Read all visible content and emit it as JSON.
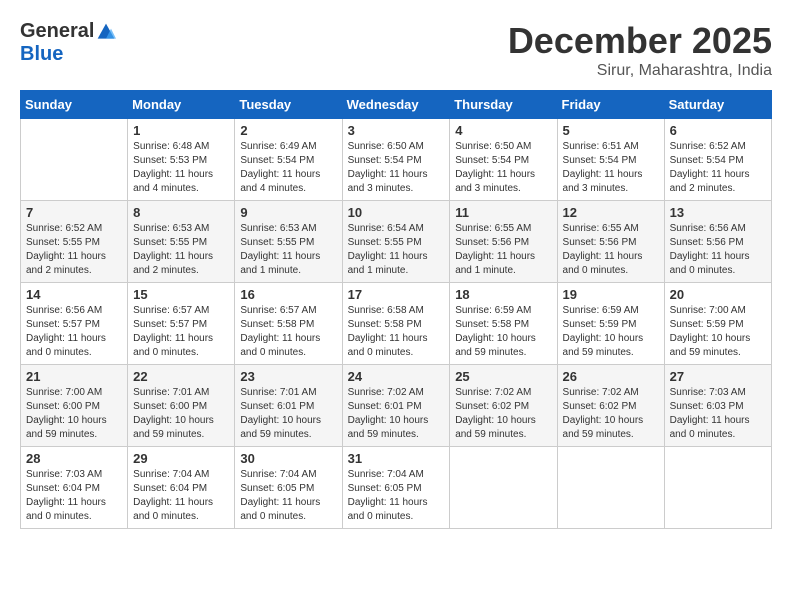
{
  "logo": {
    "general": "General",
    "blue": "Blue"
  },
  "title": {
    "month_year": "December 2025",
    "location": "Sirur, Maharashtra, India"
  },
  "days_of_week": [
    "Sunday",
    "Monday",
    "Tuesday",
    "Wednesday",
    "Thursday",
    "Friday",
    "Saturday"
  ],
  "weeks": [
    [
      {
        "day": "",
        "sunrise": "",
        "sunset": "",
        "daylight": ""
      },
      {
        "day": "1",
        "sunrise": "Sunrise: 6:48 AM",
        "sunset": "Sunset: 5:53 PM",
        "daylight": "Daylight: 11 hours and 4 minutes."
      },
      {
        "day": "2",
        "sunrise": "Sunrise: 6:49 AM",
        "sunset": "Sunset: 5:54 PM",
        "daylight": "Daylight: 11 hours and 4 minutes."
      },
      {
        "day": "3",
        "sunrise": "Sunrise: 6:50 AM",
        "sunset": "Sunset: 5:54 PM",
        "daylight": "Daylight: 11 hours and 3 minutes."
      },
      {
        "day": "4",
        "sunrise": "Sunrise: 6:50 AM",
        "sunset": "Sunset: 5:54 PM",
        "daylight": "Daylight: 11 hours and 3 minutes."
      },
      {
        "day": "5",
        "sunrise": "Sunrise: 6:51 AM",
        "sunset": "Sunset: 5:54 PM",
        "daylight": "Daylight: 11 hours and 3 minutes."
      },
      {
        "day": "6",
        "sunrise": "Sunrise: 6:52 AM",
        "sunset": "Sunset: 5:54 PM",
        "daylight": "Daylight: 11 hours and 2 minutes."
      }
    ],
    [
      {
        "day": "7",
        "sunrise": "Sunrise: 6:52 AM",
        "sunset": "Sunset: 5:55 PM",
        "daylight": "Daylight: 11 hours and 2 minutes."
      },
      {
        "day": "8",
        "sunrise": "Sunrise: 6:53 AM",
        "sunset": "Sunset: 5:55 PM",
        "daylight": "Daylight: 11 hours and 2 minutes."
      },
      {
        "day": "9",
        "sunrise": "Sunrise: 6:53 AM",
        "sunset": "Sunset: 5:55 PM",
        "daylight": "Daylight: 11 hours and 1 minute."
      },
      {
        "day": "10",
        "sunrise": "Sunrise: 6:54 AM",
        "sunset": "Sunset: 5:55 PM",
        "daylight": "Daylight: 11 hours and 1 minute."
      },
      {
        "day": "11",
        "sunrise": "Sunrise: 6:55 AM",
        "sunset": "Sunset: 5:56 PM",
        "daylight": "Daylight: 11 hours and 1 minute."
      },
      {
        "day": "12",
        "sunrise": "Sunrise: 6:55 AM",
        "sunset": "Sunset: 5:56 PM",
        "daylight": "Daylight: 11 hours and 0 minutes."
      },
      {
        "day": "13",
        "sunrise": "Sunrise: 6:56 AM",
        "sunset": "Sunset: 5:56 PM",
        "daylight": "Daylight: 11 hours and 0 minutes."
      }
    ],
    [
      {
        "day": "14",
        "sunrise": "Sunrise: 6:56 AM",
        "sunset": "Sunset: 5:57 PM",
        "daylight": "Daylight: 11 hours and 0 minutes."
      },
      {
        "day": "15",
        "sunrise": "Sunrise: 6:57 AM",
        "sunset": "Sunset: 5:57 PM",
        "daylight": "Daylight: 11 hours and 0 minutes."
      },
      {
        "day": "16",
        "sunrise": "Sunrise: 6:57 AM",
        "sunset": "Sunset: 5:58 PM",
        "daylight": "Daylight: 11 hours and 0 minutes."
      },
      {
        "day": "17",
        "sunrise": "Sunrise: 6:58 AM",
        "sunset": "Sunset: 5:58 PM",
        "daylight": "Daylight: 11 hours and 0 minutes."
      },
      {
        "day": "18",
        "sunrise": "Sunrise: 6:59 AM",
        "sunset": "Sunset: 5:58 PM",
        "daylight": "Daylight: 10 hours and 59 minutes."
      },
      {
        "day": "19",
        "sunrise": "Sunrise: 6:59 AM",
        "sunset": "Sunset: 5:59 PM",
        "daylight": "Daylight: 10 hours and 59 minutes."
      },
      {
        "day": "20",
        "sunrise": "Sunrise: 7:00 AM",
        "sunset": "Sunset: 5:59 PM",
        "daylight": "Daylight: 10 hours and 59 minutes."
      }
    ],
    [
      {
        "day": "21",
        "sunrise": "Sunrise: 7:00 AM",
        "sunset": "Sunset: 6:00 PM",
        "daylight": "Daylight: 10 hours and 59 minutes."
      },
      {
        "day": "22",
        "sunrise": "Sunrise: 7:01 AM",
        "sunset": "Sunset: 6:00 PM",
        "daylight": "Daylight: 10 hours and 59 minutes."
      },
      {
        "day": "23",
        "sunrise": "Sunrise: 7:01 AM",
        "sunset": "Sunset: 6:01 PM",
        "daylight": "Daylight: 10 hours and 59 minutes."
      },
      {
        "day": "24",
        "sunrise": "Sunrise: 7:02 AM",
        "sunset": "Sunset: 6:01 PM",
        "daylight": "Daylight: 10 hours and 59 minutes."
      },
      {
        "day": "25",
        "sunrise": "Sunrise: 7:02 AM",
        "sunset": "Sunset: 6:02 PM",
        "daylight": "Daylight: 10 hours and 59 minutes."
      },
      {
        "day": "26",
        "sunrise": "Sunrise: 7:02 AM",
        "sunset": "Sunset: 6:02 PM",
        "daylight": "Daylight: 10 hours and 59 minutes."
      },
      {
        "day": "27",
        "sunrise": "Sunrise: 7:03 AM",
        "sunset": "Sunset: 6:03 PM",
        "daylight": "Daylight: 11 hours and 0 minutes."
      }
    ],
    [
      {
        "day": "28",
        "sunrise": "Sunrise: 7:03 AM",
        "sunset": "Sunset: 6:04 PM",
        "daylight": "Daylight: 11 hours and 0 minutes."
      },
      {
        "day": "29",
        "sunrise": "Sunrise: 7:04 AM",
        "sunset": "Sunset: 6:04 PM",
        "daylight": "Daylight: 11 hours and 0 minutes."
      },
      {
        "day": "30",
        "sunrise": "Sunrise: 7:04 AM",
        "sunset": "Sunset: 6:05 PM",
        "daylight": "Daylight: 11 hours and 0 minutes."
      },
      {
        "day": "31",
        "sunrise": "Sunrise: 7:04 AM",
        "sunset": "Sunset: 6:05 PM",
        "daylight": "Daylight: 11 hours and 0 minutes."
      },
      {
        "day": "",
        "sunrise": "",
        "sunset": "",
        "daylight": ""
      },
      {
        "day": "",
        "sunrise": "",
        "sunset": "",
        "daylight": ""
      },
      {
        "day": "",
        "sunrise": "",
        "sunset": "",
        "daylight": ""
      }
    ]
  ]
}
